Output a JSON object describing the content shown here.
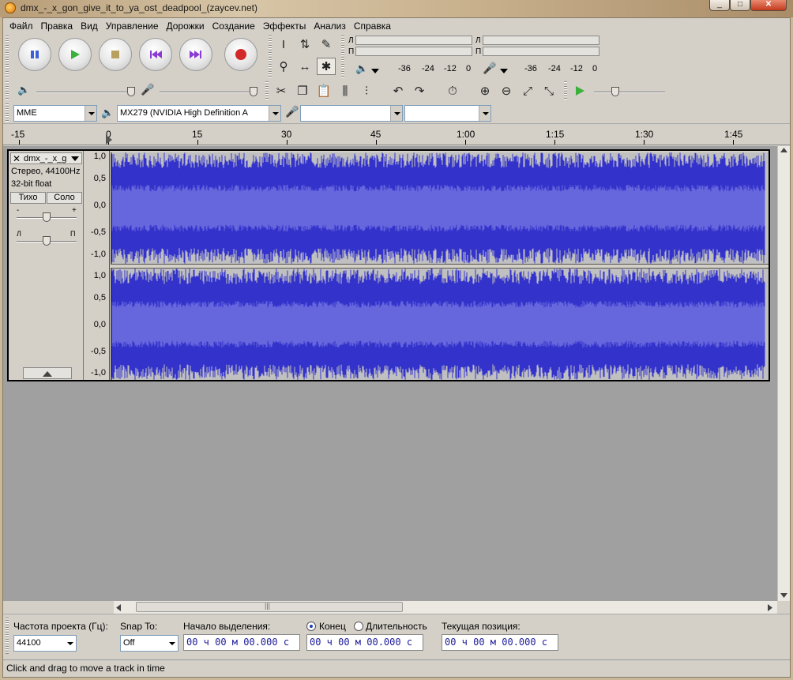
{
  "window": {
    "title": "dmx_-_x_gon_give_it_to_ya_ost_deadpool_(zaycev.net)"
  },
  "menu": [
    "Файл",
    "Правка",
    "Вид",
    "Управление",
    "Дорожки",
    "Создание",
    "Эффекты",
    "Анализ",
    "Справка"
  ],
  "meters": {
    "left_label": "Л",
    "right_label": "П",
    "play_ticks": [
      "-36",
      "-24",
      "-12",
      "0"
    ],
    "rec_ticks": [
      "-36",
      "-24",
      "-12",
      "0"
    ]
  },
  "devices": {
    "host": "MME",
    "output": "MX279 (NVIDIA High Definition A",
    "input": "",
    "channels": ""
  },
  "ruler": {
    "labels": [
      "-15",
      "0",
      "15",
      "30",
      "45",
      "1:00",
      "1:15",
      "1:30",
      "1:45"
    ]
  },
  "track": {
    "name": "dmx_-_x_g",
    "info_line1": "Стерео, 44100Hz",
    "info_line2": "32-bit float",
    "mute_label": "Тихо",
    "solo_label": "Соло",
    "gain_minus": "-",
    "gain_plus": "+",
    "pan_left": "Л",
    "pan_right": "П",
    "vruler_labels": [
      "1,0",
      "0,5",
      "0,0",
      "-0,5",
      "-1,0"
    ]
  },
  "selection_bar": {
    "rate_label": "Частота проекта (Гц):",
    "rate_value": "44100",
    "snap_label": "Snap To:",
    "snap_value": "Off",
    "start_label": "Начало выделения:",
    "end_label": "Конец",
    "length_label": "Длительность",
    "position_label": "Текущая позиция:",
    "start_time": "00 ч 00 м 00.000 с",
    "end_time": "00 ч 00 м 00.000 с",
    "position_time": "00 ч 00 м 00.000 с"
  },
  "status": {
    "text": "Click and drag to move a track in time"
  },
  "colors": {
    "waveform": "#3333cc",
    "waveform_rms": "#6666dd",
    "wave_bg": "#c0c0c0",
    "workspace": "#a0a0a0"
  }
}
